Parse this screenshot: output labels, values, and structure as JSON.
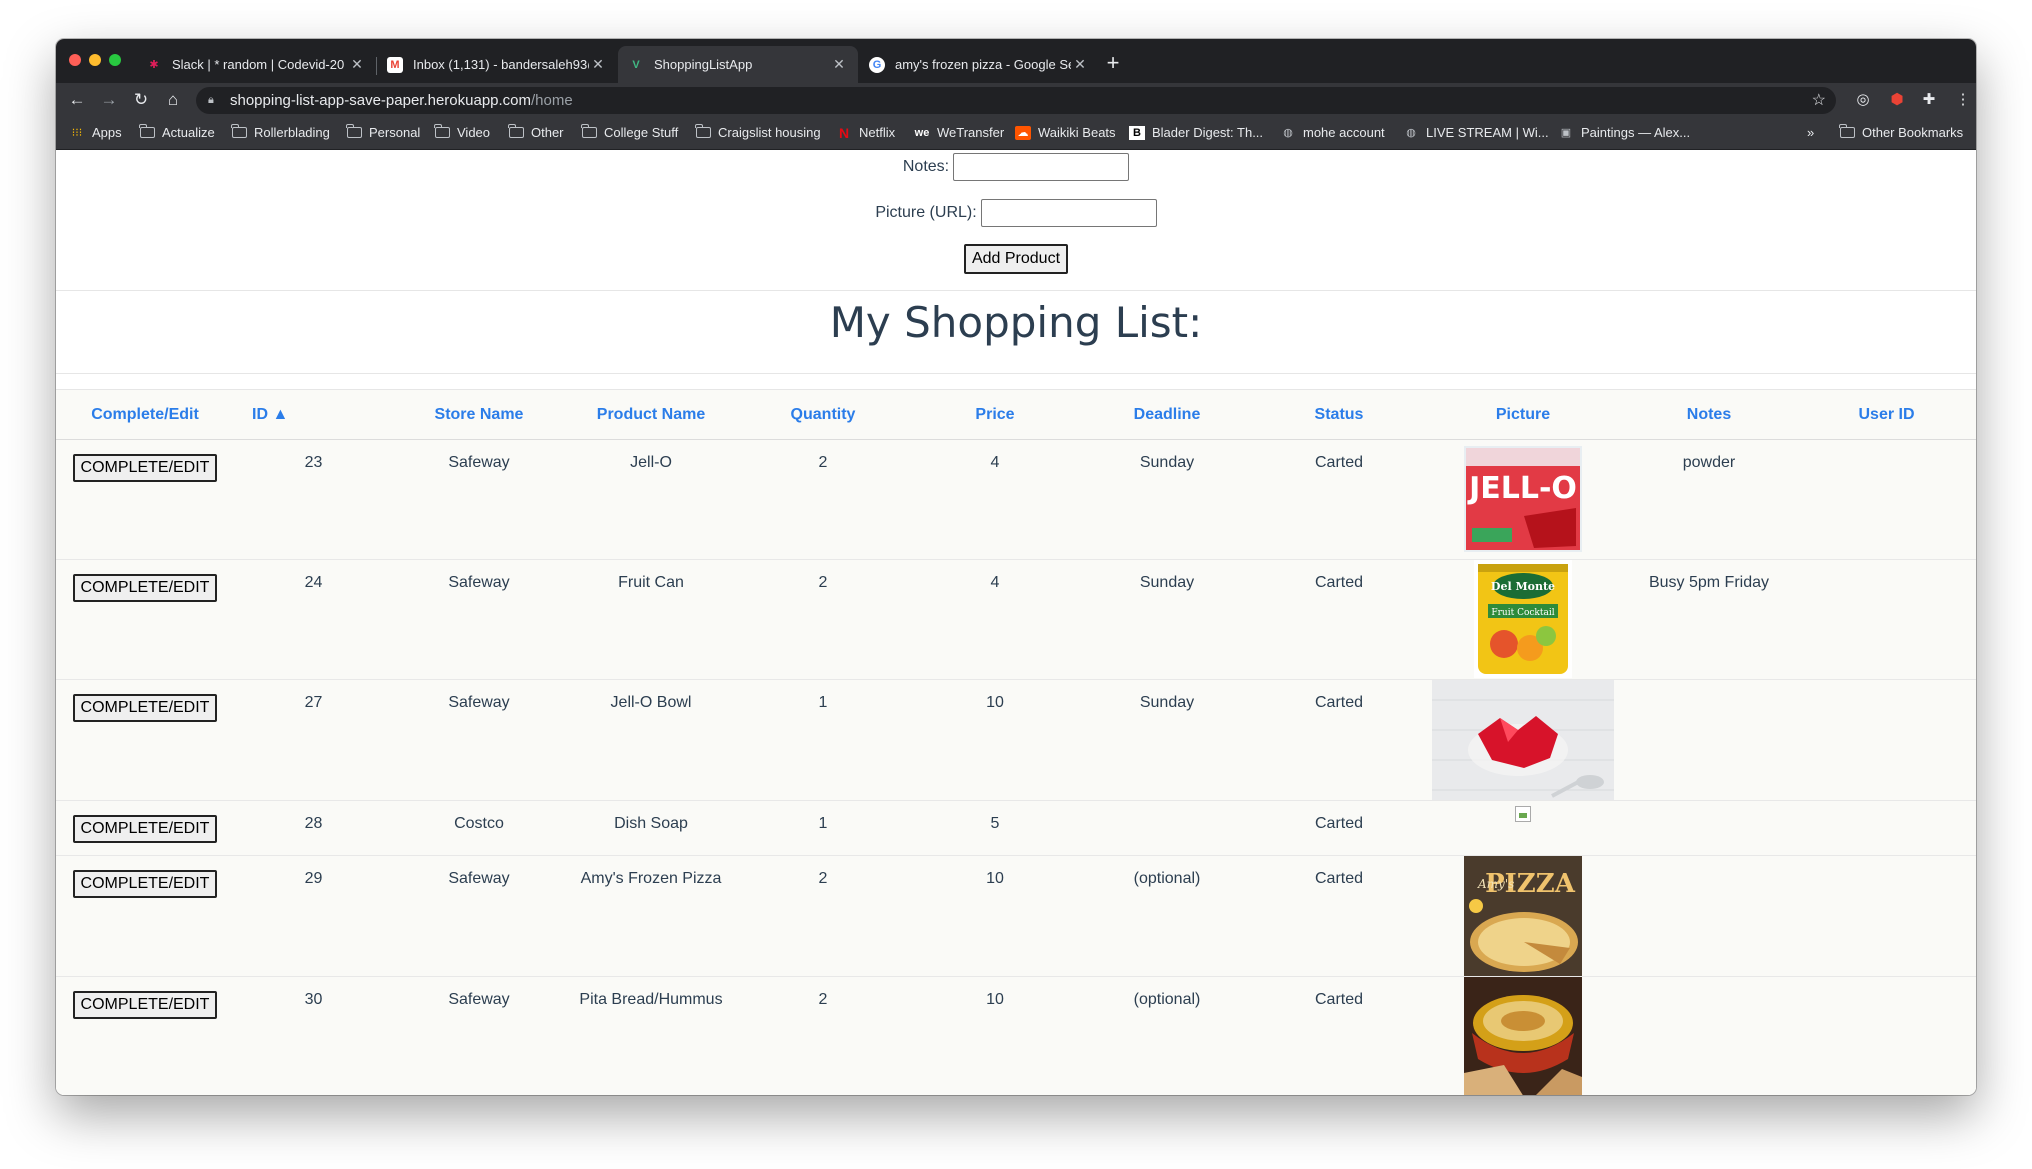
{
  "browser": {
    "tabs": [
      {
        "title": "Slack | * random | Codevid-20",
        "icon": "slack-icon"
      },
      {
        "title": "Inbox (1,131) - bandersaleh93@",
        "icon": "gmail-icon"
      },
      {
        "title": "ShoppingListApp",
        "icon": "vue-icon"
      },
      {
        "title": "amy's frozen pizza - Google Se",
        "icon": "google-icon"
      }
    ],
    "url_host": "shopping-list-app-save-paper.herokuapp.com",
    "url_path": "/home",
    "bookmarks": [
      {
        "label": "Apps",
        "icon": "apps-grid-icon"
      },
      {
        "label": "Actualize",
        "icon": "folder-icon"
      },
      {
        "label": "Rollerblading",
        "icon": "folder-icon"
      },
      {
        "label": "Personal",
        "icon": "folder-icon"
      },
      {
        "label": "Video",
        "icon": "folder-icon"
      },
      {
        "label": "Other",
        "icon": "folder-icon"
      },
      {
        "label": "College Stuff",
        "icon": "folder-icon"
      },
      {
        "label": "Craigslist housing",
        "icon": "folder-icon"
      },
      {
        "label": "Netflix",
        "icon": "netflix-icon"
      },
      {
        "label": "WeTransfer",
        "icon": "wetransfer-icon"
      },
      {
        "label": "Waikiki Beats",
        "icon": "soundcloud-icon"
      },
      {
        "label": "Blader Digest: Th...",
        "icon": "blader-icon"
      },
      {
        "label": "mohe account",
        "icon": "globe-icon"
      },
      {
        "label": "LIVE STREAM | Wi...",
        "icon": "globe-icon"
      },
      {
        "label": "Paintings — Alex...",
        "icon": "squarespace-icon"
      }
    ],
    "overflow": "»",
    "other_bookmarks": "Other Bookmarks"
  },
  "form": {
    "notes_label": "Notes:",
    "picture_label": "Picture (URL):",
    "add_button": "Add Product"
  },
  "heading": "My Shopping List:",
  "table": {
    "headers": [
      "Complete/Edit",
      "ID ▲",
      "Store Name",
      "Product Name",
      "Quantity",
      "Price",
      "Deadline",
      "Status",
      "Picture",
      "Notes",
      "User ID"
    ],
    "button_label": "COMPLETE/EDIT",
    "rows": [
      {
        "id": "23",
        "store": "Safeway",
        "product": "Jell-O",
        "quantity": "2",
        "price": "4",
        "deadline": "Sunday",
        "status": "Carted",
        "picture": "jello-box",
        "notes": "powder",
        "user_id": ""
      },
      {
        "id": "24",
        "store": "Safeway",
        "product": "Fruit Can",
        "quantity": "2",
        "price": "4",
        "deadline": "Sunday",
        "status": "Carted",
        "picture": "fruit-can",
        "notes": "Busy 5pm Friday",
        "user_id": ""
      },
      {
        "id": "27",
        "store": "Safeway",
        "product": "Jell-O Bowl",
        "quantity": "1",
        "price": "10",
        "deadline": "Sunday",
        "status": "Carted",
        "picture": "jello-bowl",
        "notes": "",
        "user_id": ""
      },
      {
        "id": "28",
        "store": "Costco",
        "product": "Dish Soap",
        "quantity": "1",
        "price": "5",
        "deadline": "",
        "status": "Carted",
        "picture": "broken",
        "notes": "",
        "user_id": ""
      },
      {
        "id": "29",
        "store": "Safeway",
        "product": "Amy's Frozen Pizza",
        "quantity": "2",
        "price": "10",
        "deadline": "(optional)",
        "status": "Carted",
        "picture": "pizza-box",
        "notes": "",
        "user_id": ""
      },
      {
        "id": "30",
        "store": "Safeway",
        "product": "Pita Bread/Hummus",
        "quantity": "2",
        "price": "10",
        "deadline": "(optional)",
        "status": "Carted",
        "picture": "hummus",
        "notes": "",
        "user_id": ""
      }
    ]
  }
}
